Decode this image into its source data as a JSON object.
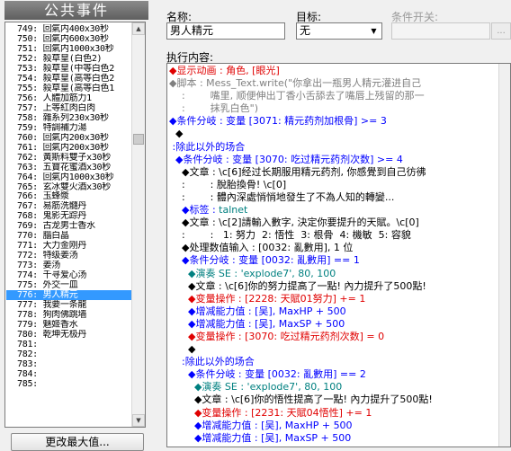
{
  "left_panel": {
    "title": "公共事件",
    "events": [
      "749: 回氣内400x30秒",
      "750: 回氣内600x30秒",
      "751: 回氣内1000x30秒",
      "752: 殺草皇(白色2)",
      "753: 殺草皇(中等白色2",
      "754: 殺草皇(高等白色2",
      "755: 殺草皇(高等白色1",
      "756: 人體加筋力1",
      "757: 上等紅肉白肉",
      "758: 雜系列230x30秒",
      "759: 特調補力湯",
      "760: 回氣内200x30秒",
      "761: 回氣内200x30秒",
      "762: 黃斯料雙子x30秒",
      "763: 五寶花蜜酒x30秒",
      "764: 回氣内1000x30秒",
      "765: 玄冰雙火酒x30秒",
      "766: 玉蜂漿",
      "767: 易筋洗髓丹",
      "768: 鬼影无踪丹",
      "769: 古龙男士香水",
      "770: 腦白晶",
      "771: 大力金刚丹",
      "772: 特级姜汤",
      "773: 姜汤",
      "774: 千寻爱心汤",
      "775: 外交一皿",
      "776: 男人精元",
      "777: 我要一条龍",
      "778: 狗肉佛跳墙",
      "779: 魅姬香水",
      "780: 乾坤无极丹",
      "781:",
      "782:",
      "783:",
      "784:",
      "785:"
    ],
    "selected_index": 27,
    "max_button": "更改最大值..."
  },
  "right_panel": {
    "name_label": "名称:",
    "name_value": "男人精元",
    "target_label": "目标:",
    "target_value": "无",
    "switch_label": "条件开关:",
    "content_label": "执行内容:"
  },
  "commands": [
    [
      [
        "rd",
        "◆显示动画 : 角色, [眼光]"
      ]
    ],
    [
      [
        "gr",
        "◆脚本 : Mess_Text.write(\"你拿出一瓶男人精元灌进自己"
      ]
    ],
    [
      [
        "gr",
        "    :        嘴里, 顺便伸出丁香小舌舔去了嘴唇上残留的那一"
      ]
    ],
    [
      [
        "gr",
        "    :        抹乳白色\")"
      ]
    ],
    [
      [
        "bl",
        "◆条件分岐 : 变量 [3071: 精元药剂加根骨] >= 3"
      ]
    ],
    [
      [
        "bk",
        "  ◆"
      ]
    ],
    [
      [
        "bl",
        " :除此以外的场合"
      ]
    ],
    [
      [
        "bl",
        "  ◆条件分岐 : 变量 [3070: 吃过精元药剂次数] >= 4"
      ]
    ],
    [
      [
        "bk",
        "    ◆文章 : \\c[6]经过长期服用精元药剂, 你感覺到自己彷彿"
      ]
    ],
    [
      [
        "bk",
        "    :        : 脫胎換骨! \\c[0]"
      ]
    ],
    [
      [
        "bk",
        "    :        : 體內深處悄悄地發生了不為人知的轉變..."
      ]
    ],
    [
      [
        "bl",
        "    ◆标签 : "
      ],
      [
        "tl",
        "talnet"
      ]
    ],
    [
      [
        "bk",
        "    ◆文章 : \\c[2]請輸入數字, 決定你要提升的天賦。\\c[0]"
      ]
    ],
    [
      [
        "bk",
        "    :        :   1: 努力  2: 悟性  3: 根骨  4: 機敏  5: 容貌"
      ]
    ],
    [
      [
        "bk",
        "    ◆处理数值输入 : [0032: 亂數用], 1 位"
      ]
    ],
    [
      [
        "bl",
        "    ◆条件分岐 : 变量 [0032: 亂數用] == 1"
      ]
    ],
    [
      [
        "tl",
        "      ◆演奏 SE : 'explode7', 80, 100"
      ]
    ],
    [
      [
        "bk",
        "      ◆文章 : \\c[6]你的努力提高了一點! 內力提升了500點!"
      ]
    ],
    [
      [
        "rd",
        "      ◆变量操作 : [2228: 天賦01努力] += 1"
      ]
    ],
    [
      [
        "bl",
        "      ◆增减能力值 : [吴], MaxHP + 500"
      ]
    ],
    [
      [
        "bl",
        "      ◆增减能力值 : [吴], MaxSP + 500"
      ]
    ],
    [
      [
        "rd",
        "      ◆变量操作 : [3070: 吃过精元药剂次数] = 0"
      ]
    ],
    [
      [
        "bk",
        "      ◆"
      ]
    ],
    [
      [
        "bl",
        "    :除此以外的场合"
      ]
    ],
    [
      [
        "bl",
        "      ◆条件分岐 : 变量 [0032: 亂數用] == 2"
      ]
    ],
    [
      [
        "tl",
        "        ◆演奏 SE : 'explode7', 80, 100"
      ]
    ],
    [
      [
        "bk",
        "        ◆文章 : \\c[6]你的悟性提高了一點! 內力提升了500點!"
      ]
    ],
    [
      [
        "rd",
        "        ◆变量操作 : [2231: 天賦04悟性] += 1"
      ]
    ],
    [
      [
        "bl",
        "        ◆增减能力值 : [吴], MaxHP + 500"
      ]
    ],
    [
      [
        "bl",
        "        ◆增减能力值 : [吴], MaxSP + 500"
      ]
    ]
  ],
  "colors": {
    "selection": "#3399ff",
    "title_bg": "#6b6b6b",
    "blue": "#0000ff",
    "red": "#e00000",
    "teal": "#008080",
    "gray": "#808080"
  }
}
